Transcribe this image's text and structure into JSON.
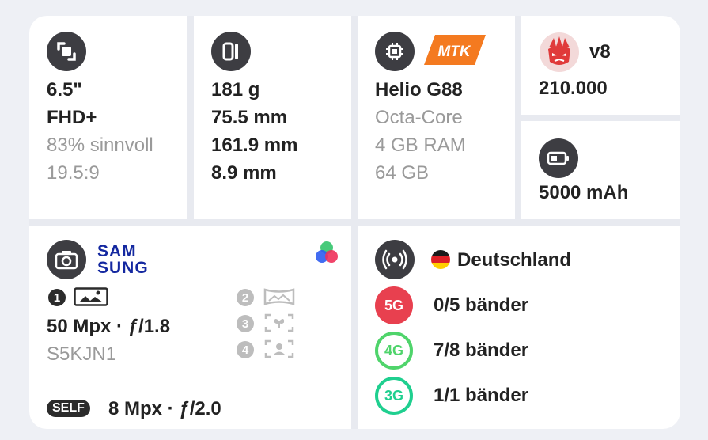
{
  "display": {
    "size": "6.5\"",
    "resolution": "FHD+",
    "screen_ratio": "83% sinnvoll",
    "aspect": "19.5:9"
  },
  "body": {
    "weight": "181 g",
    "width": "75.5 mm",
    "height": "161.9 mm",
    "thickness": "8.9 mm"
  },
  "soc": {
    "brand_logo": "MTK",
    "name": "Helio G88",
    "cores": "Octa-Core",
    "ram": "4 GB RAM",
    "storage": "64 GB"
  },
  "antutu": {
    "version": "v8",
    "score": "210.000"
  },
  "battery": {
    "capacity": "5000 mAh"
  },
  "camera": {
    "sensor_brand_line1": "SAM",
    "sensor_brand_line2": "SUNG",
    "main_index": "1",
    "main_spec": "50 Mpx · ƒ/1.8",
    "main_sensor": "S5KJN1",
    "lens_2_index": "2",
    "lens_3_index": "3",
    "lens_4_index": "4",
    "selfie_badge": "SELF",
    "selfie_spec": "8 Mpx · ƒ/2.0"
  },
  "network": {
    "country": "Deutschland",
    "bands": [
      {
        "label": "5G",
        "value": "0/5 bänder",
        "color": "#e8404f"
      },
      {
        "label": "4G",
        "value": "7/8 bänder",
        "color": "#4fd46b"
      },
      {
        "label": "3G",
        "value": "1/1 bänder",
        "color": "#1fcf8f"
      }
    ]
  },
  "colors": {
    "mtk_orange": "#f47a20",
    "antutu_red": "#e03a3a",
    "samsung_blue": "#1428a0",
    "icon_dark": "#3d3d42"
  }
}
